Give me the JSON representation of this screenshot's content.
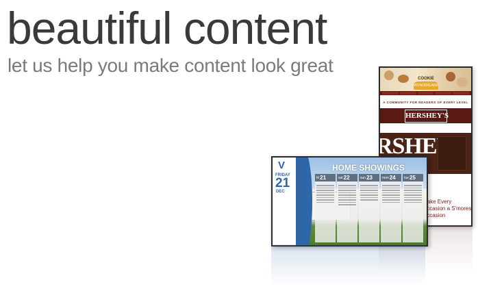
{
  "hero": {
    "headline": "beautiful content",
    "subheadline": "let us help you make content look great"
  },
  "hershey_sign": {
    "banner_title": "COOKIE",
    "banner_badge": "WONDERLAND",
    "tagline_top": "A COMMUNITY FOR READERS OF EVERY LEVEL",
    "logo": "HERSHEY'S",
    "bar_text": "RSHEY",
    "tagline": "Make Every Occasion a S'mores Occasion",
    "colors": {
      "brown": "#5a1a12",
      "accent": "#e7a82b"
    }
  },
  "home_sign": {
    "title": "HOME SHOWINGS",
    "weekday": "FRIDAY",
    "day": "21",
    "month": "DEC",
    "columns": [
      {
        "dow": "fri",
        "num": "21"
      },
      {
        "dow": "sat",
        "num": "22"
      },
      {
        "dow": "sun",
        "num": "23"
      },
      {
        "dow": "mon",
        "num": "24"
      },
      {
        "dow": "tue",
        "num": "25"
      }
    ],
    "colors": {
      "blue": "#2e66a8"
    }
  }
}
